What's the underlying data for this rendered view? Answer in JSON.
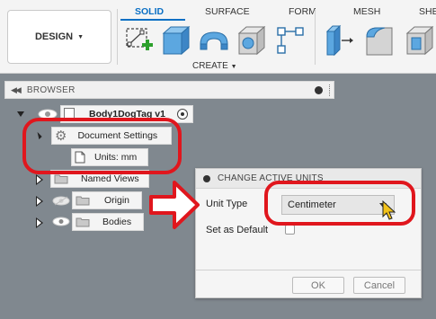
{
  "toolbar": {
    "workspace_label": "DESIGN",
    "tabs": [
      {
        "label": "SOLID"
      },
      {
        "label": "SURFACE"
      },
      {
        "label": "FORM"
      },
      {
        "label": "MESH"
      },
      {
        "label": "SHE"
      }
    ],
    "group_label": "CREATE",
    "tools": [
      "create-sketch-icon",
      "extrude-icon",
      "revolve-icon",
      "hole-icon",
      "pattern-icon",
      "split-body-icon",
      "fillet-icon",
      "shell-icon"
    ]
  },
  "browser": {
    "title": "BROWSER",
    "root": {
      "label": "Body1DogTag v1"
    },
    "items": [
      {
        "label": "Document Settings"
      },
      {
        "label": "Units: mm"
      },
      {
        "label": "Named Views"
      },
      {
        "label": "Origin"
      },
      {
        "label": "Bodies"
      }
    ]
  },
  "dialog": {
    "title": "CHANGE ACTIVE UNITS",
    "unit_type_label": "Unit Type",
    "unit_type_value": "Centimeter",
    "set_default_label": "Set as Default",
    "set_default_checked": false,
    "ok_label": "OK",
    "cancel_label": "Cancel"
  },
  "colors": {
    "accent": "#0a6fc4",
    "annotation": "#e0161d",
    "canvas": "#80888f"
  }
}
